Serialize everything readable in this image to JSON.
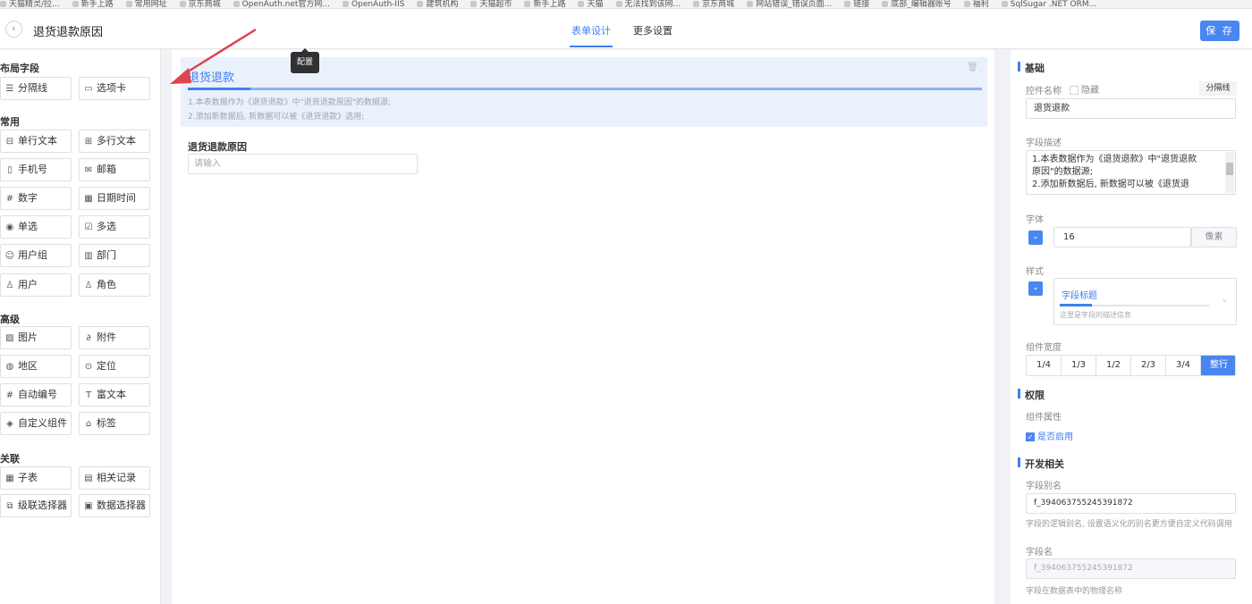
{
  "browser": {
    "bookmarks": [
      "天猫精灵/拉...",
      "新手上路",
      "常用网址",
      "京东商城",
      "OpenAuth.net官方网...",
      "OpenAuth-IIS",
      "建筑机构",
      "天猫超市",
      "新手上路",
      "天猫",
      "无法找到该网...",
      "京东商城",
      "网站错误_错误页面...",
      "链接",
      "底部_编辑器账号",
      "福利",
      "SqlSugar .NET ORM..."
    ]
  },
  "header": {
    "back_icon": "chevron-left-icon",
    "title": "退货退款原因",
    "tabs": [
      {
        "label": "表单设计",
        "active": true
      },
      {
        "label": "更多设置",
        "active": false
      }
    ],
    "save_label": "保 存",
    "tooltip": "配置"
  },
  "left_panel": {
    "groups": [
      {
        "title": "布局字段",
        "items": [
          {
            "label": "分隔线",
            "icon": "divider-icon"
          },
          {
            "label": "选项卡",
            "icon": "tabs-icon"
          }
        ]
      },
      {
        "title": "常用",
        "items": [
          {
            "label": "单行文本",
            "icon": "single-line-text-icon"
          },
          {
            "label": "多行文本",
            "icon": "multi-line-text-icon"
          },
          {
            "label": "手机号",
            "icon": "phone-icon"
          },
          {
            "label": "邮箱",
            "icon": "mail-icon"
          },
          {
            "label": "数字",
            "icon": "number-icon"
          },
          {
            "label": "日期时间",
            "icon": "calendar-icon"
          },
          {
            "label": "单选",
            "icon": "radio-icon"
          },
          {
            "label": "多选",
            "icon": "checkbox-icon"
          },
          {
            "label": "用户组",
            "icon": "user-group-icon"
          },
          {
            "label": "部门",
            "icon": "department-icon"
          },
          {
            "label": "用户",
            "icon": "user-icon"
          },
          {
            "label": "角色",
            "icon": "role-icon"
          }
        ]
      },
      {
        "title": "高级",
        "items": [
          {
            "label": "图片",
            "icon": "image-icon"
          },
          {
            "label": "附件",
            "icon": "attachment-icon"
          },
          {
            "label": "地区",
            "icon": "region-icon"
          },
          {
            "label": "定位",
            "icon": "location-icon"
          },
          {
            "label": "自动编号",
            "icon": "hash-icon"
          },
          {
            "label": "富文本",
            "icon": "rich-text-icon"
          },
          {
            "label": "自定义组件",
            "icon": "custom-component-icon"
          },
          {
            "label": "标签",
            "icon": "tag-icon"
          }
        ]
      },
      {
        "title": "关联",
        "items": [
          {
            "label": "子表",
            "icon": "subtable-icon"
          },
          {
            "label": "相关记录",
            "icon": "related-records-icon"
          },
          {
            "label": "级联选择器",
            "icon": "cascader-icon"
          },
          {
            "label": "数据选择器",
            "icon": "data-selector-icon"
          }
        ]
      }
    ]
  },
  "canvas": {
    "divider": {
      "title": "退货退款",
      "desc_line1": "1.本表数据作为《退货退款》中\"退货退款原因\"的数据源;",
      "desc_line2": "2.添加新数据后, 新数据可以被《退货退款》选用;"
    },
    "field": {
      "label": "退货退款原因",
      "placeholder": "请输入"
    }
  },
  "right_panel": {
    "basic": {
      "title": "基础",
      "name_label": "控件名称",
      "hidden_label": "隐藏",
      "type_tag": "分隔线",
      "name_value": "退货退款",
      "desc_label": "字段描述",
      "desc_line1": "1.本表数据作为《退货退款》中\"退货退款",
      "desc_line2": "原因\"的数据源;",
      "desc_line3": "2.添加新数据后, 新数据可以被《退货退",
      "font_label": "字体",
      "font_value": "16",
      "font_unit": "像素",
      "style_label": "样式",
      "style_preview_title": "字段标题",
      "style_preview_desc": "这里是字段的描述信息",
      "width_label": "组件宽度",
      "width_options": [
        {
          "label": "1/4",
          "active": false
        },
        {
          "label": "1/3",
          "active": false
        },
        {
          "label": "1/2",
          "active": false
        },
        {
          "label": "2/3",
          "active": false
        },
        {
          "label": "3/4",
          "active": false
        },
        {
          "label": "整行",
          "active": true
        }
      ]
    },
    "permission": {
      "title": "权限",
      "attr_label": "组件属性",
      "enabled_label": "是否启用",
      "enabled": true
    },
    "dev": {
      "title": "开发相关",
      "alias_label": "字段别名",
      "alias_value": "f_394063755245391872",
      "alias_help": "字段的逻辑别名, 设置语义化的别名更方便自定义代码调用",
      "field_label": "字段名",
      "field_value": "f_394063755245391872",
      "field_help": "字段在数据表中的物理名称"
    }
  },
  "colors": {
    "accent": "#3d7ff0",
    "annotation_arrow": "#e0424e"
  }
}
